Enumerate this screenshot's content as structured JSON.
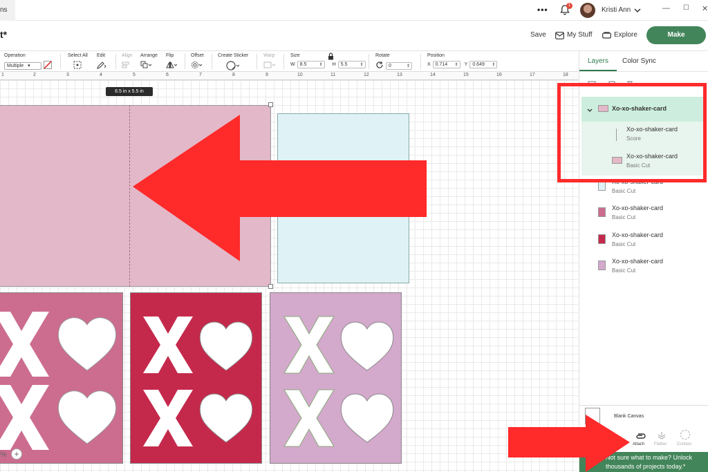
{
  "titlebar": {
    "tab_fragment": "ns",
    "more_label": "•••",
    "notification_count": "1",
    "user_name": "Kristi Ann",
    "window_controls": [
      "—",
      "☐",
      "✕"
    ]
  },
  "header": {
    "project_title_fragment": "t*",
    "save_label": "Save",
    "my_stuff_label": "My Stuff",
    "explore_label": "Explore",
    "make_label": "Make"
  },
  "toolbar": {
    "operation_label": "Operation",
    "operation_value": "Multiple",
    "select_all_label": "Select All",
    "edit_label": "Edit",
    "align_label": "Align",
    "arrange_label": "Arrange",
    "flip_label": "Flip",
    "offset_label": "Offset",
    "create_sticker_label": "Create Sticker",
    "warp_label": "Warp",
    "size_label": "Size",
    "w_label": "W",
    "w_value": "8.5",
    "h_label": "H",
    "h_value": "5.5",
    "rotate_label": "Rotate",
    "rotate_value": "0",
    "position_label": "Position",
    "x_label": "X",
    "x_value": "0.714",
    "y_label": "Y",
    "y_value": "0.649"
  },
  "ruler": {
    "ticks": [
      "1",
      "2",
      "3",
      "4",
      "5",
      "6",
      "7",
      "8",
      "9",
      "10",
      "11",
      "12",
      "13",
      "14",
      "15",
      "16",
      "17",
      "18"
    ]
  },
  "canvas": {
    "size_tooltip": "8.5  in x 5.5  in",
    "zoom_fragment": "%",
    "colors": {
      "pink_card": "#e3b8c8",
      "light_blue_card": "#dff2f5",
      "rose_panel": "#cc6d8f",
      "red_panel": "#c4294b",
      "lilac_panel": "#d3a9cc",
      "annotation_red": "#ff2a2a"
    }
  },
  "layers_panel": {
    "tab_layers": "Layers",
    "tab_color_sync": "Color Sync",
    "group": {
      "name": "Xo-xo-shaker-card"
    },
    "items": [
      {
        "name": "Xo-xo-shaker-card",
        "type": "Score",
        "swatch": "line"
      },
      {
        "name": "Xo-xo-shaker-card",
        "type": "Basic Cut",
        "swatch": "#e3b8c8"
      },
      {
        "name": "Xo-xo-shaker-card",
        "type": "Basic Cut",
        "swatch": "#dff2f5"
      },
      {
        "name": "Xo-xo-shaker-card",
        "type": "Basic Cut",
        "swatch": "#cc6d8f"
      },
      {
        "name": "Xo-xo-shaker-card",
        "type": "Basic Cut",
        "swatch": "#c4294b"
      },
      {
        "name": "Xo-xo-shaker-card",
        "type": "Basic Cut",
        "swatch": "#d3a9cc"
      }
    ],
    "blank_canvas_label": "Blank Canvas",
    "attach_label": "Attach",
    "flatten_label": "Flatten",
    "contour_label": "Contour",
    "promo_text_1": "Not sure what to make? Unlock",
    "promo_text_2": "thousands of projects today.*"
  }
}
